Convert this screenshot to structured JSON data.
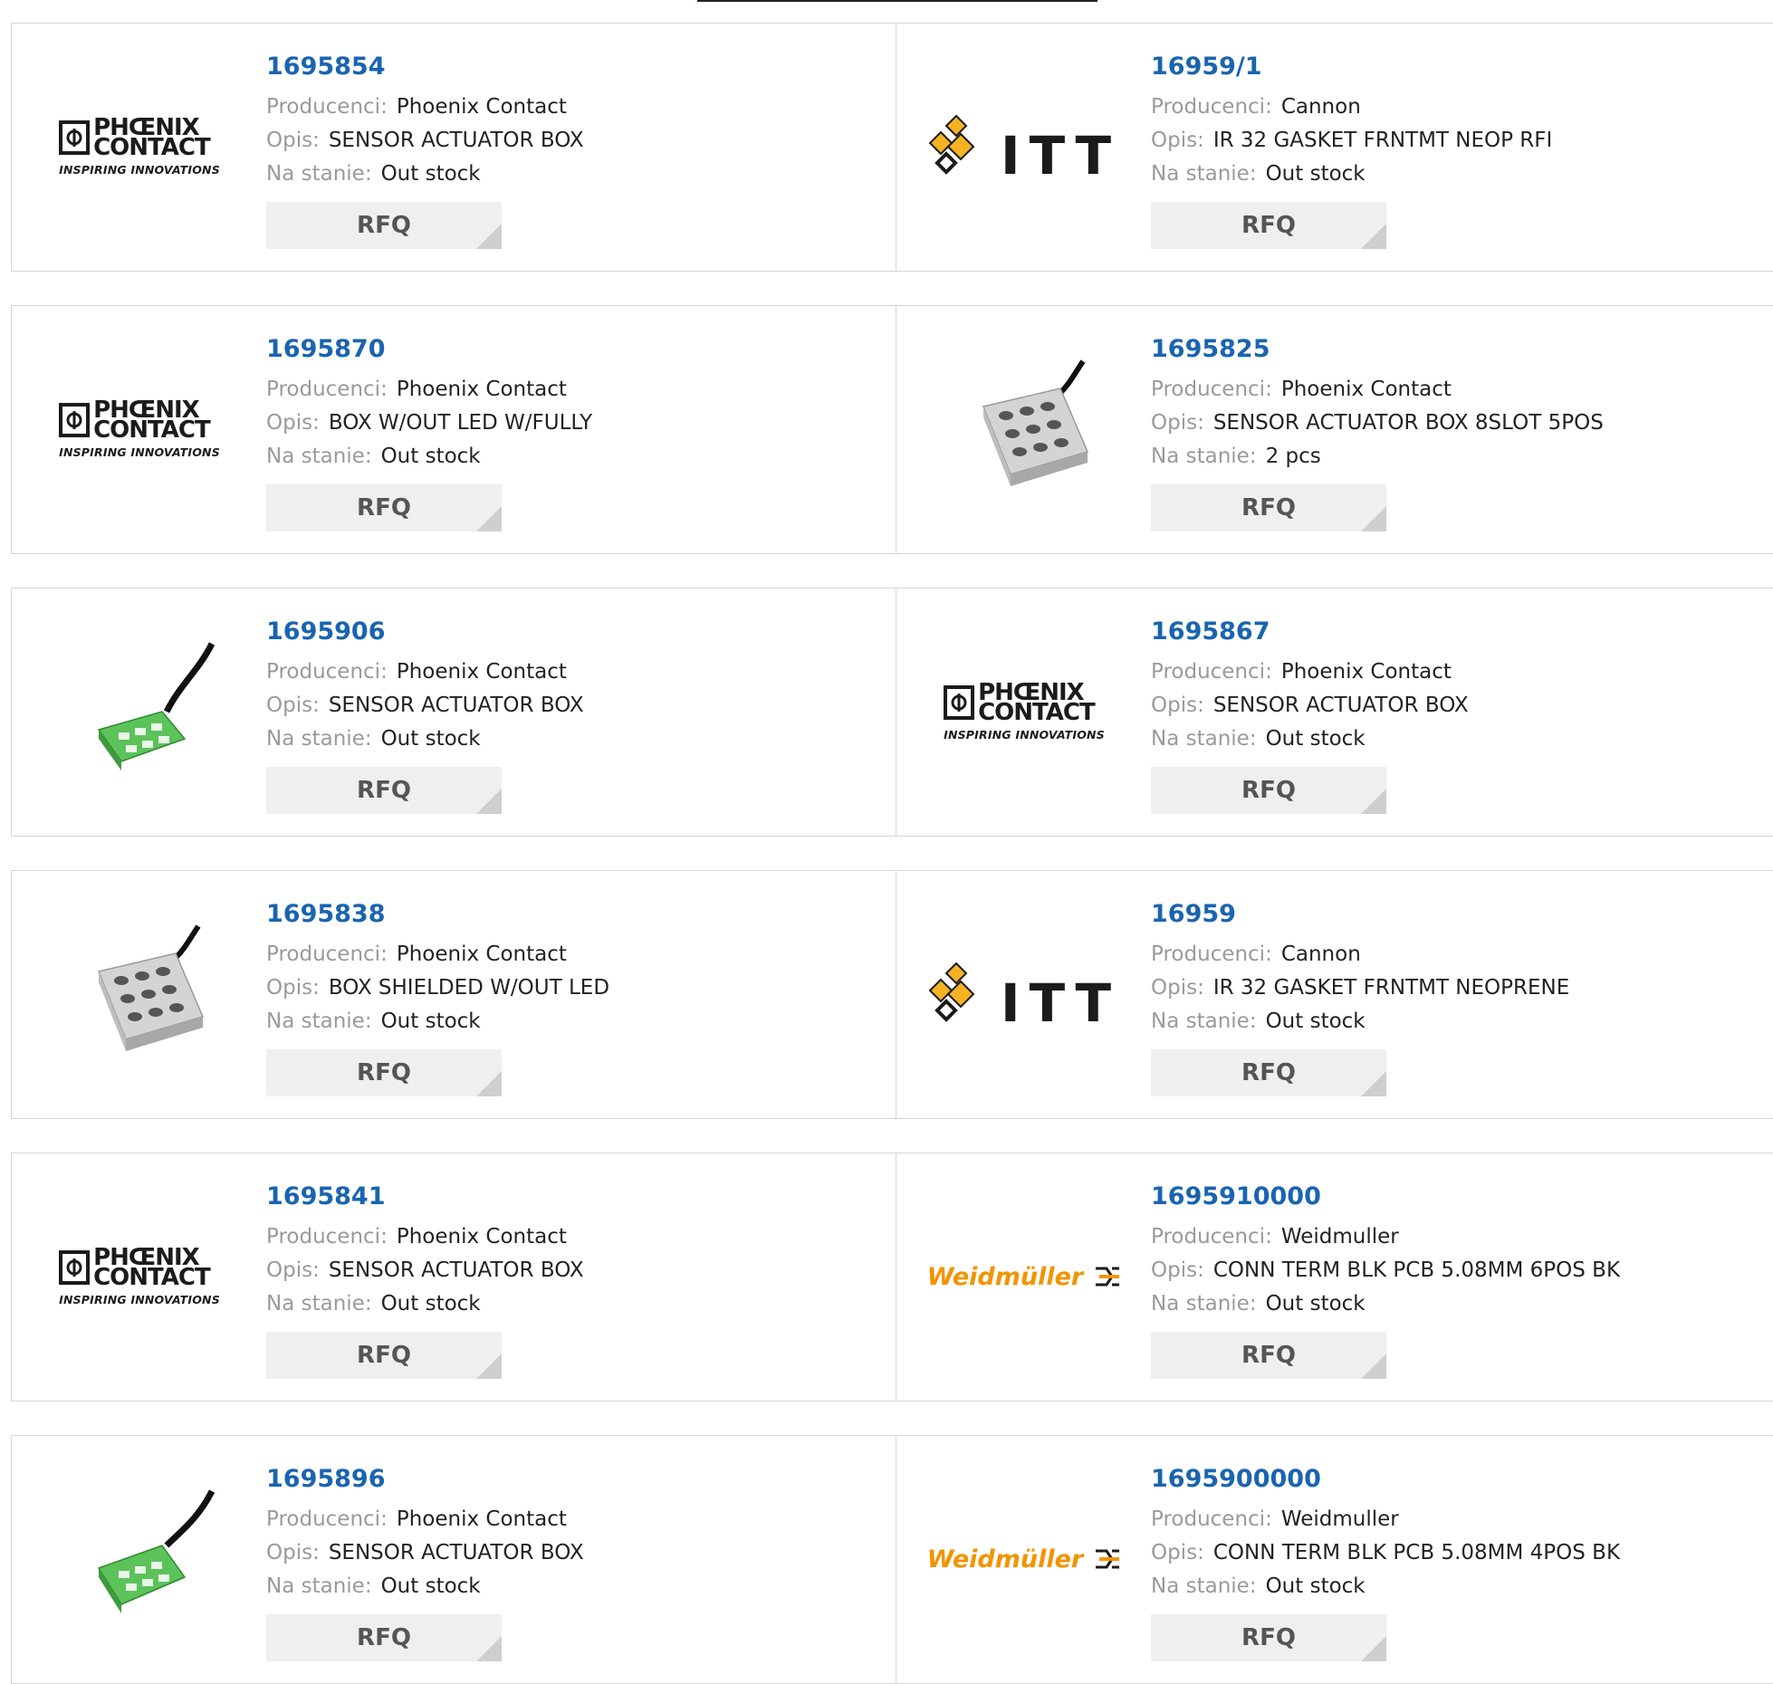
{
  "labels": {
    "manufacturer": "Producenci:",
    "description": "Opis:",
    "stock": "Na stanie:",
    "rfq": "RFQ"
  },
  "logos": {
    "phoenix_line1": "PHŒNIX",
    "phoenix_line2": "CONTACT",
    "phoenix_tag": "INSPIRING INNOVATIONS",
    "itt": "ITT",
    "weidmuller": "Weidmüller"
  },
  "colors": {
    "part_link": "#1a64b0",
    "weidmuller_orange": "#f29400",
    "itt_gold": "#f5b324",
    "phoenix_green": "#5cc25a"
  },
  "products": [
    {
      "part": "1695854",
      "manufacturer": "Phoenix Contact",
      "description": "SENSOR ACTUATOR BOX",
      "stock": "Out stock",
      "image": "phoenix-logo"
    },
    {
      "part": "16959/1",
      "manufacturer": "Cannon",
      "description": "IR 32 GASKET FRNTMT NEOP RFI",
      "stock": "Out stock",
      "image": "itt-logo"
    },
    {
      "part": "1695870",
      "manufacturer": "Phoenix Contact",
      "description": "BOX W/OUT LED W/FULLY",
      "stock": "Out stock",
      "image": "phoenix-logo"
    },
    {
      "part": "1695825",
      "manufacturer": "Phoenix Contact",
      "description": "SENSOR ACTUATOR BOX 8SLOT 5POS",
      "stock": "2 pcs",
      "image": "grey-sensor-box"
    },
    {
      "part": "1695906",
      "manufacturer": "Phoenix Contact",
      "description": "SENSOR ACTUATOR BOX",
      "stock": "Out stock",
      "image": "green-sensor-box-small"
    },
    {
      "part": "1695867",
      "manufacturer": "Phoenix Contact",
      "description": "SENSOR ACTUATOR BOX",
      "stock": "Out stock",
      "image": "phoenix-logo"
    },
    {
      "part": "1695838",
      "manufacturer": "Phoenix Contact",
      "description": "BOX SHIELDED W/OUT LED",
      "stock": "Out stock",
      "image": "grey-sensor-box"
    },
    {
      "part": "16959",
      "manufacturer": "Cannon",
      "description": "IR 32 GASKET FRNTMT NEOPRENE",
      "stock": "Out stock",
      "image": "itt-logo"
    },
    {
      "part": "1695841",
      "manufacturer": "Phoenix Contact",
      "description": "SENSOR ACTUATOR BOX",
      "stock": "Out stock",
      "image": "phoenix-logo"
    },
    {
      "part": "1695910000",
      "manufacturer": "Weidmuller",
      "description": "CONN TERM BLK PCB 5.08MM 6POS BK",
      "stock": "Out stock",
      "image": "weidmuller-logo"
    },
    {
      "part": "1695896",
      "manufacturer": "Phoenix Contact",
      "description": "SENSOR ACTUATOR BOX",
      "stock": "Out stock",
      "image": "green-sensor-box-large"
    },
    {
      "part": "1695900000",
      "manufacturer": "Weidmuller",
      "description": "CONN TERM BLK PCB 5.08MM 4POS BK",
      "stock": "Out stock",
      "image": "weidmuller-logo"
    }
  ]
}
